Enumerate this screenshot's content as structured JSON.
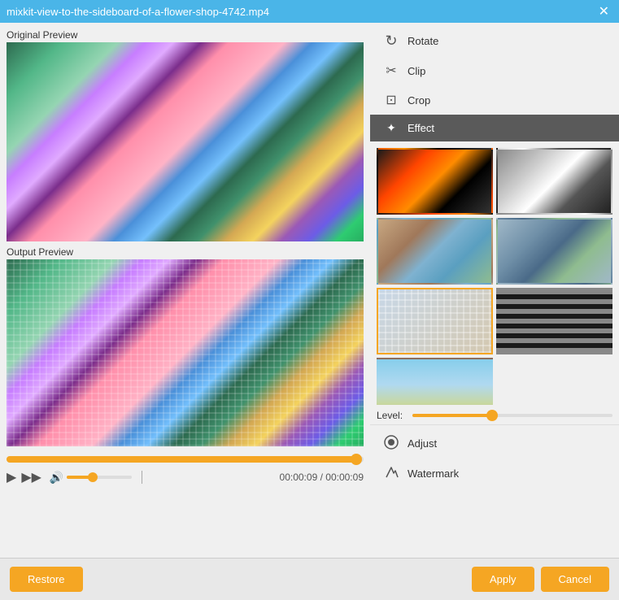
{
  "titlebar": {
    "title": "mixkit-view-to-the-sideboard-of-a-flower-shop-4742.mp4",
    "close_label": "✕"
  },
  "left_panel": {
    "original_label": "Original Preview",
    "output_label": "Output Preview",
    "time_current": "00:00:09",
    "time_total": "00:00:09",
    "time_separator": "/"
  },
  "right_panel": {
    "menu_items": [
      {
        "id": "rotate",
        "icon": "↻",
        "label": "Rotate"
      },
      {
        "id": "clip",
        "icon": "✂",
        "label": "Clip"
      },
      {
        "id": "crop",
        "icon": "⊞",
        "label": "Crop"
      },
      {
        "id": "effect",
        "icon": "✦",
        "label": "Effect",
        "active": true
      }
    ],
    "bottom_menu_items": [
      {
        "id": "adjust",
        "label": "Adjust"
      },
      {
        "id": "watermark",
        "label": "Watermark"
      }
    ],
    "level_label": "Level:",
    "effects": [
      {
        "id": "sketch",
        "class": "effect-sketch"
      },
      {
        "id": "bw",
        "class": "effect-bw"
      },
      {
        "id": "normal1",
        "class": "effect-normal1"
      },
      {
        "id": "normal2",
        "class": "effect-normal2"
      },
      {
        "id": "crossstitch",
        "class": "effect-crossstitch",
        "selected": true
      },
      {
        "id": "blinds",
        "class": "effect-blinds"
      },
      {
        "id": "sky",
        "class": "effect-sky"
      }
    ]
  },
  "footer": {
    "restore_label": "Restore",
    "apply_label": "Apply",
    "cancel_label": "Cancel"
  }
}
